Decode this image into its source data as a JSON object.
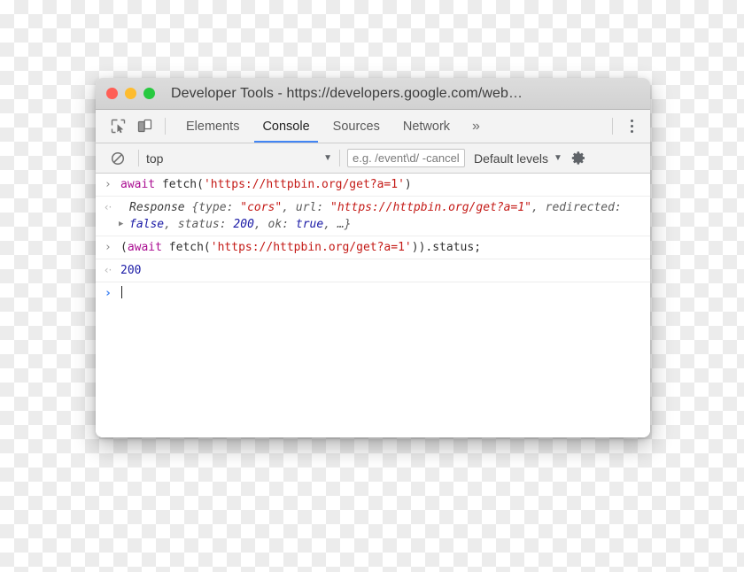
{
  "window": {
    "title": "Developer Tools - https://developers.google.com/web…",
    "lights": [
      {
        "name": "close",
        "color": "#ff5f56"
      },
      {
        "name": "minimize",
        "color": "#febc2e"
      },
      {
        "name": "zoom",
        "color": "#27c93f"
      }
    ]
  },
  "tabbar": {
    "inspect_icon": "inspect-element-icon",
    "device_icon": "device-toolbar-icon",
    "tabs": [
      {
        "label": "Elements",
        "active": false
      },
      {
        "label": "Console",
        "active": true
      },
      {
        "label": "Sources",
        "active": false
      },
      {
        "label": "Network",
        "active": false
      }
    ],
    "more_label": "»",
    "menu_icon": "more-vertical-icon",
    "active_underline_color": "#4285f4"
  },
  "filterbar": {
    "clear_icon": "clear-console-icon",
    "context": {
      "value": "top",
      "caret": "▼"
    },
    "filter": {
      "placeholder": "e.g. /event\\d/ -cancel",
      "value": ""
    },
    "levels": {
      "label": "Default levels",
      "caret": "▼"
    },
    "settings_icon": "gear-icon"
  },
  "console": {
    "rows": [
      {
        "type": "input",
        "gutter": "›",
        "tokens": [
          {
            "cls": "kw",
            "text": "await"
          },
          {
            "cls": "pln",
            "text": " fetch("
          },
          {
            "cls": "str",
            "text": "'https://httpbin.org/get?a=1'"
          },
          {
            "cls": "pln",
            "text": ")"
          }
        ]
      },
      {
        "type": "output-object",
        "gutter": "‹·",
        "triangle": "▶",
        "tokens": [
          {
            "cls": "cls",
            "text": "Response "
          },
          {
            "cls": "prop",
            "text": "{type: "
          },
          {
            "cls": "str",
            "text": "\"cors\""
          },
          {
            "cls": "prop",
            "text": ", url: "
          },
          {
            "cls": "str",
            "text": "\"https://httpbin.org/get?a=1\""
          },
          {
            "cls": "prop",
            "text": ", redirected: "
          },
          {
            "cls": "bool",
            "text": "false"
          },
          {
            "cls": "prop",
            "text": ", status: "
          },
          {
            "cls": "num",
            "text": "200"
          },
          {
            "cls": "prop",
            "text": ", ok: "
          },
          {
            "cls": "bool",
            "text": "true"
          },
          {
            "cls": "prop",
            "text": ", …}"
          }
        ]
      },
      {
        "type": "input",
        "gutter": "›",
        "tokens": [
          {
            "cls": "pln",
            "text": "("
          },
          {
            "cls": "kw",
            "text": "await"
          },
          {
            "cls": "pln",
            "text": " fetch("
          },
          {
            "cls": "str",
            "text": "'https://httpbin.org/get?a=1'"
          },
          {
            "cls": "pln",
            "text": ")).status;"
          }
        ]
      },
      {
        "type": "output",
        "gutter": "‹·",
        "tokens": [
          {
            "cls": "num",
            "text": "200"
          }
        ]
      },
      {
        "type": "prompt",
        "gutter": "›",
        "tokens": []
      }
    ]
  }
}
